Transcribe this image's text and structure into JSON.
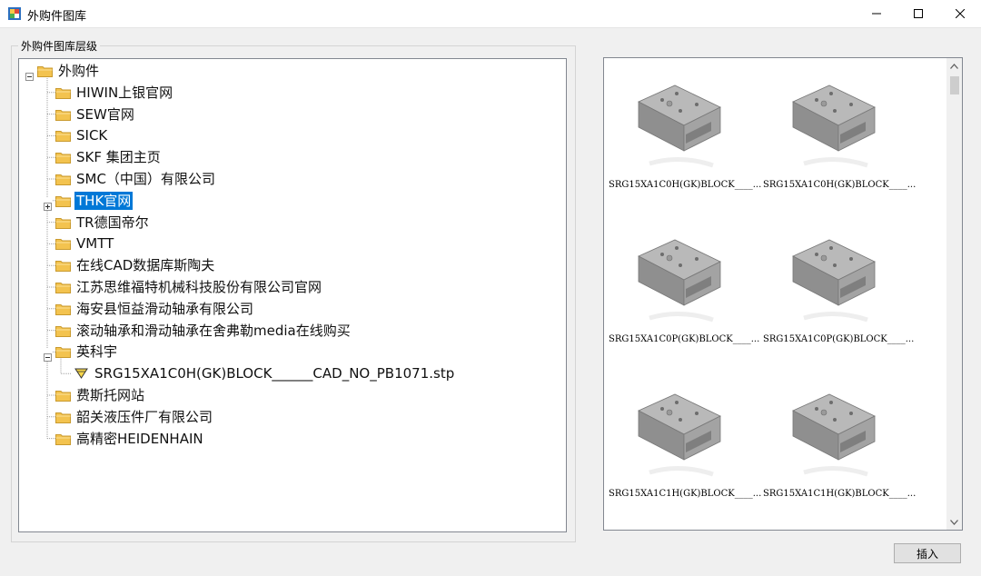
{
  "window": {
    "title": "外购件图库",
    "controls": [
      "minimize",
      "maximize",
      "close"
    ]
  },
  "group": {
    "label": "外购件图库层级"
  },
  "tree": {
    "root": "外购件",
    "items": [
      {
        "label": "HIWIN上银官网",
        "icon": "folder-icon"
      },
      {
        "label": "SEW官网",
        "icon": "folder-icon"
      },
      {
        "label": "SICK",
        "icon": "folder-icon"
      },
      {
        "label": "SKF 集团主页",
        "icon": "folder-icon"
      },
      {
        "label": "SMC（中国）有限公司",
        "icon": "folder-icon"
      },
      {
        "label": "THK官网",
        "icon": "folder-icon",
        "selected": true,
        "expandable": true
      },
      {
        "label": "TR德国帝尔",
        "icon": "folder-icon"
      },
      {
        "label": "VMTT",
        "icon": "folder-icon"
      },
      {
        "label": "在线CAD数据库斯陶夫",
        "icon": "folder-icon"
      },
      {
        "label": "江苏思维福特机械科技股份有限公司官网",
        "icon": "folder-icon"
      },
      {
        "label": "海安县恒益滑动轴承有限公司",
        "icon": "folder-icon"
      },
      {
        "label": "滚动轴承和滑动轴承在舍弗勒media在线购买",
        "icon": "folder-icon"
      },
      {
        "label": "英科宇",
        "icon": "folder-icon",
        "expanded": true
      },
      {
        "label": "SRG15XA1C0H(GK)BLOCK______CAD_NO_PB1071.stp",
        "icon": "stp-file-icon",
        "child": true
      },
      {
        "label": "费斯托网站",
        "icon": "folder-icon"
      },
      {
        "label": "韶关液压件厂有限公司",
        "icon": "folder-icon"
      },
      {
        "label": "高精密HEIDENHAIN",
        "icon": "folder-icon"
      }
    ]
  },
  "preview": {
    "thumbnails": [
      {
        "caption": "SRG15XA1C0H(GK)BLOCK____..."
      },
      {
        "caption": "SRG15XA1C0H(GK)BLOCK____..."
      },
      {
        "caption": "SRG15XA1C0P(GK)BLOCK____..."
      },
      {
        "caption": "SRG15XA1C0P(GK)BLOCK____..."
      },
      {
        "caption": "SRG15XA1C1H(GK)BLOCK____..."
      },
      {
        "caption": "SRG15XA1C1H(GK)BLOCK____..."
      }
    ]
  },
  "buttons": {
    "insert": "插入"
  },
  "colors": {
    "selection": "#0078d7",
    "folder": "#f3c34f",
    "window_bg": "#f0f0f0"
  }
}
